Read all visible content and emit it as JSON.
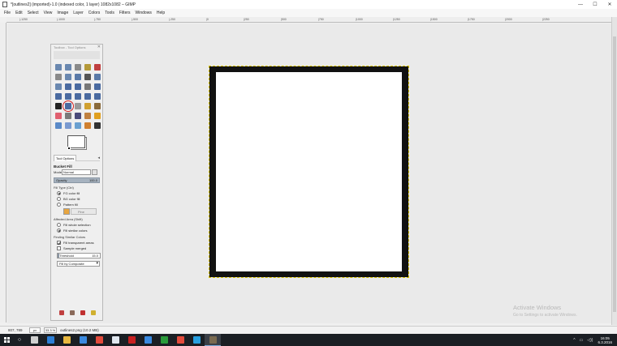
{
  "window": {
    "title": "*[outlines2] (imported)-1.0 (indexed color, 1 layer) 1082x1082 – GIMP",
    "min": "—",
    "max": "☐",
    "close": "✕"
  },
  "menu": [
    "File",
    "Edit",
    "Select",
    "View",
    "Image",
    "Layer",
    "Colors",
    "Tools",
    "Filters",
    "Windows",
    "Help"
  ],
  "ruler": [
    "|-1250",
    "|-1000",
    "|-750",
    "|-500",
    "|-250",
    "|0",
    "|250",
    "|500",
    "|750",
    "|1000",
    "|1250",
    "|1500",
    "|1750",
    "|2000",
    "|2250"
  ],
  "toolbox": {
    "title": "Toolbox - Tool Options",
    "close": "✕",
    "tools": [
      {
        "name": "rect-select-icon",
        "color": "#6a88b0"
      },
      {
        "name": "ellipse-select-icon",
        "color": "#6a88b0"
      },
      {
        "name": "free-select-icon",
        "color": "#8a8a8a"
      },
      {
        "name": "fuzzy-select-icon",
        "color": "#b59a3a"
      },
      {
        "name": "select-by-color-icon",
        "color": "#c04040"
      },
      {
        "name": "scissors-icon",
        "color": "#8a8a8a"
      },
      {
        "name": "foreground-select-icon",
        "color": "#6a88b0"
      },
      {
        "name": "paths-icon",
        "color": "#5a7aa8"
      },
      {
        "name": "color-picker-icon",
        "color": "#555555"
      },
      {
        "name": "zoom-icon",
        "color": "#5a7aa8"
      },
      {
        "name": "measure-icon",
        "color": "#6a88b0"
      },
      {
        "name": "move-icon",
        "color": "#4a6aa0"
      },
      {
        "name": "align-icon",
        "color": "#4a6aa0"
      },
      {
        "name": "crop-icon",
        "color": "#777777"
      },
      {
        "name": "rotate-icon",
        "color": "#4a6aa0"
      },
      {
        "name": "scale-icon",
        "color": "#4a6aa0"
      },
      {
        "name": "shear-icon",
        "color": "#4a6aa0"
      },
      {
        "name": "perspective-icon",
        "color": "#4a6aa0"
      },
      {
        "name": "flip-icon",
        "color": "#4a6aa0"
      },
      {
        "name": "cage-icon",
        "color": "#4a6aa0"
      },
      {
        "name": "text-icon",
        "color": "#222222"
      },
      {
        "name": "bucket-fill-icon",
        "color": "#4a6aa0"
      },
      {
        "name": "blend-icon",
        "color": "#9a9a9a"
      },
      {
        "name": "pencil-icon",
        "color": "#d0a030"
      },
      {
        "name": "paintbrush-icon",
        "color": "#8a6a3a"
      },
      {
        "name": "eraser-icon",
        "color": "#e06070"
      },
      {
        "name": "airbrush-icon",
        "color": "#7a7a7a"
      },
      {
        "name": "ink-icon",
        "color": "#4a4a7a"
      },
      {
        "name": "mypaint-brush-icon",
        "color": "#c08040"
      },
      {
        "name": "clone-icon",
        "color": "#e0a020"
      },
      {
        "name": "heal-icon",
        "color": "#5a8ac8"
      },
      {
        "name": "perspective-clone-icon",
        "color": "#7a9ad0"
      },
      {
        "name": "blur-icon",
        "color": "#6aa0d0"
      },
      {
        "name": "smudge-icon",
        "color": "#d08030"
      },
      {
        "name": "dodge-burn-icon",
        "color": "#333333"
      }
    ],
    "selected_tool": "bucket-fill-icon"
  },
  "tool_options": {
    "tab": "Tool Options",
    "tab_menu": "◂",
    "heading": "Bucket Fill",
    "mode_label": "Mode",
    "mode": "Normal",
    "opacity_label": "Opacity",
    "opacity": "100.0",
    "fill_type_label": "Fill Type  (Ctrl)",
    "fill_types": [
      "FG color fill",
      "BG color fill",
      "Pattern fill"
    ],
    "fill_type_selected": 0,
    "pattern_name": "Pine",
    "affected_label": "Affected Area  (Shift)",
    "affected_options": [
      "Fill whole selection",
      "Fill similar colors"
    ],
    "affected_selected": 1,
    "similar_label": "Finding Similar Colors",
    "fill_transparent": "Fill transparent areas",
    "fill_transparent_checked": true,
    "sample_merged": "Sample merged",
    "sample_merged_checked": false,
    "threshold_label": "Threshold",
    "threshold": "15.0",
    "fill_by": "Fill by Composite"
  },
  "status": {
    "coords": "807, 789",
    "unit": "px",
    "zoom": "33.3 %",
    "info": "outlines2.png (10.2 MB)"
  },
  "watermark": {
    "line1": "Activate Windows",
    "line2": "Go to Settings to activate Windows."
  },
  "taskbar": {
    "search": "○",
    "apps": [
      {
        "name": "task-view-icon",
        "color": "#d0d0d0"
      },
      {
        "name": "edge-icon",
        "color": "#2d7fd6"
      },
      {
        "name": "file-explorer-icon",
        "color": "#e8b840"
      },
      {
        "name": "store-icon",
        "color": "#3a8ae0"
      },
      {
        "name": "chrome-icon",
        "color": "#e34b3c"
      },
      {
        "name": "notepad-icon",
        "color": "#dfe6ee"
      },
      {
        "name": "acrobat-icon",
        "color": "#c82020"
      },
      {
        "name": "windows-icon",
        "color": "#3a8ae0"
      },
      {
        "name": "xbox-icon",
        "color": "#2a9a3a"
      },
      {
        "name": "chrome-2-icon",
        "color": "#e34b3c"
      },
      {
        "name": "skype-icon",
        "color": "#28a0e0"
      },
      {
        "name": "gimp-icon",
        "color": "#7a6a50"
      }
    ],
    "active_app": 11,
    "tray": [
      "^",
      "▭",
      "◁))"
    ],
    "time": "16:05",
    "date": "6.3.2016"
  }
}
